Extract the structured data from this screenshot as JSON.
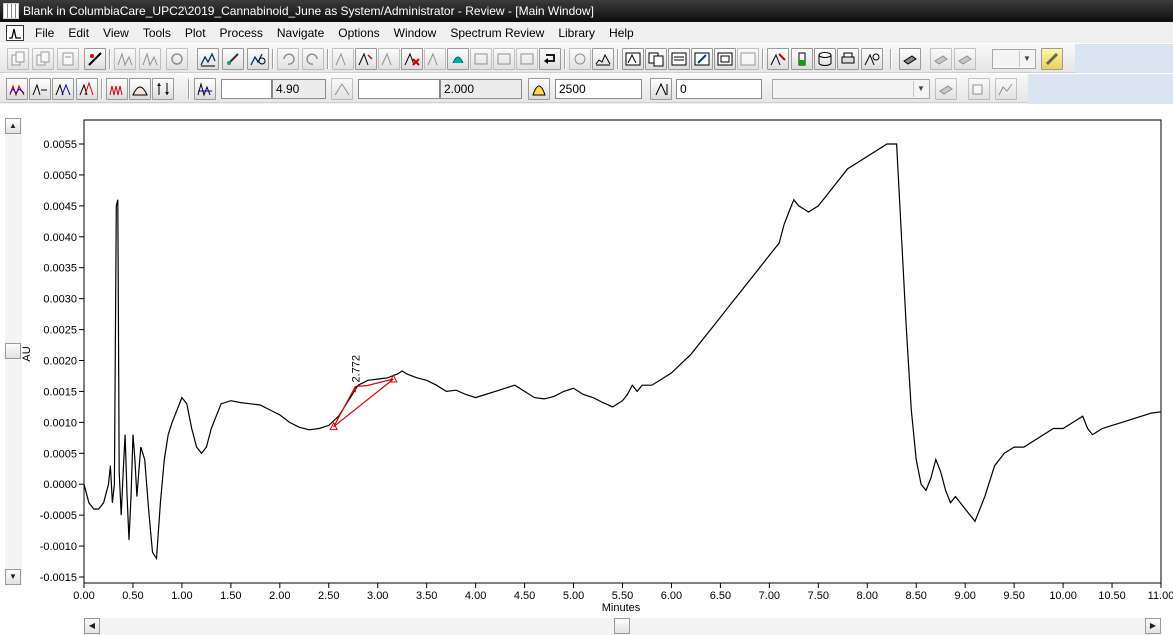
{
  "window": {
    "title": "Blank in ColumbiaCare_UPC2\\2019_Cannabinoid_June as System/Administrator - Review - [Main Window]"
  },
  "menu": [
    "File",
    "Edit",
    "View",
    "Tools",
    "Plot",
    "Process",
    "Navigate",
    "Options",
    "Window",
    "Spectrum Review",
    "Library",
    "Help"
  ],
  "toolbar2": {
    "field1_value": "4.90",
    "field2_value": "2.000",
    "field3_value": "2500",
    "field4_value": "0"
  },
  "chart_data": {
    "type": "line",
    "xlabel": "Minutes",
    "ylabel": "AU",
    "xlim": [
      0.0,
      11.0
    ],
    "ylim": [
      -0.0015,
      0.0055
    ],
    "x_ticks": [
      "0.00",
      "0.50",
      "1.00",
      "1.50",
      "2.00",
      "2.50",
      "3.00",
      "3.50",
      "4.00",
      "4.50",
      "5.00",
      "5.50",
      "6.00",
      "6.50",
      "7.00",
      "7.50",
      "8.00",
      "8.50",
      "9.00",
      "9.50",
      "10.00",
      "10.50",
      "11.00"
    ],
    "y_ticks": [
      "0.0055",
      "0.0050",
      "0.0045",
      "0.0040",
      "0.0035",
      "0.0030",
      "0.0025",
      "0.0020",
      "0.0015",
      "0.0010",
      "0.0005",
      "0.0000",
      "-0.0005",
      "-0.0010",
      "-0.0015"
    ],
    "series": [
      {
        "color": "#000000",
        "x": [
          0.0,
          0.05,
          0.1,
          0.15,
          0.2,
          0.25,
          0.27,
          0.29,
          0.31,
          0.33,
          0.345,
          0.36,
          0.38,
          0.4,
          0.42,
          0.44,
          0.46,
          0.48,
          0.5,
          0.52,
          0.54,
          0.56,
          0.58,
          0.62,
          0.66,
          0.7,
          0.74,
          0.78,
          0.82,
          0.86,
          0.9,
          0.95,
          1.0,
          1.05,
          1.1,
          1.15,
          1.2,
          1.25,
          1.3,
          1.4,
          1.5,
          1.6,
          1.7,
          1.8,
          1.9,
          2.0,
          2.1,
          2.2,
          2.3,
          2.4,
          2.5,
          2.6,
          2.7,
          2.8,
          2.9,
          3.0,
          3.1,
          3.2,
          3.25,
          3.3,
          3.4,
          3.5,
          3.6,
          3.7,
          3.8,
          3.9,
          4.0,
          4.1,
          4.2,
          4.3,
          4.4,
          4.5,
          4.6,
          4.7,
          4.8,
          4.9,
          5.0,
          5.1,
          5.2,
          5.3,
          5.4,
          5.5,
          5.55,
          5.6,
          5.65,
          5.7,
          5.8,
          5.9,
          6.0,
          6.1,
          6.2,
          6.3,
          6.4,
          6.5,
          6.6,
          6.7,
          6.8,
          6.9,
          7.0,
          7.1,
          7.15,
          7.2,
          7.25,
          7.3,
          7.35,
          7.4,
          7.5,
          7.6,
          7.7,
          7.8,
          7.9,
          8.0,
          8.1,
          8.2,
          8.3,
          8.35,
          8.4,
          8.45,
          8.5,
          8.55,
          8.6,
          8.65,
          8.7,
          8.75,
          8.8,
          8.85,
          8.9,
          8.95,
          9.0,
          9.1,
          9.2,
          9.3,
          9.4,
          9.5,
          9.6,
          9.7,
          9.8,
          9.9,
          10.0,
          10.1,
          10.2,
          10.25,
          10.3,
          10.35,
          10.4,
          10.5,
          10.6,
          10.7,
          10.8,
          10.9,
          11.0
        ],
        "y": [
          0.0,
          -0.0003,
          -0.0004,
          -0.0004,
          -0.0003,
          0.0,
          0.0003,
          -0.0003,
          0.0,
          0.0045,
          0.0046,
          0.0002,
          -0.0005,
          0.0002,
          0.0008,
          -0.0002,
          -0.0009,
          -0.0002,
          0.0008,
          0.0004,
          -0.0002,
          0.0002,
          0.0006,
          0.0004,
          -0.0004,
          -0.0011,
          -0.0012,
          -0.0003,
          0.0004,
          0.0008,
          0.001,
          0.0012,
          0.0014,
          0.0013,
          0.0009,
          0.0006,
          0.0005,
          0.0006,
          0.0009,
          0.0013,
          0.00135,
          0.00132,
          0.0013,
          0.00128,
          0.0012,
          0.00112,
          0.001,
          0.00092,
          0.00088,
          0.0009,
          0.00095,
          0.0011,
          0.00135,
          0.0016,
          0.00168,
          0.0017,
          0.00172,
          0.00178,
          0.00183,
          0.00178,
          0.00172,
          0.00168,
          0.0016,
          0.0015,
          0.00152,
          0.00145,
          0.0014,
          0.00145,
          0.0015,
          0.00155,
          0.0016,
          0.0015,
          0.0014,
          0.00138,
          0.00142,
          0.0015,
          0.00155,
          0.00145,
          0.0014,
          0.00132,
          0.00125,
          0.00135,
          0.00145,
          0.0016,
          0.0015,
          0.0016,
          0.0016,
          0.0017,
          0.0018,
          0.00195,
          0.0021,
          0.0023,
          0.0025,
          0.0027,
          0.0029,
          0.0031,
          0.0033,
          0.0035,
          0.0037,
          0.0039,
          0.0042,
          0.0044,
          0.0046,
          0.0045,
          0.00445,
          0.0044,
          0.0045,
          0.0047,
          0.0049,
          0.0051,
          0.0052,
          0.0053,
          0.0054,
          0.0055,
          0.0055,
          0.004,
          0.0025,
          0.0012,
          0.0004,
          0.0,
          -0.0001,
          0.0001,
          0.0004,
          0.0002,
          -0.0001,
          -0.0003,
          -0.0002,
          -0.0003,
          -0.0004,
          -0.0006,
          -0.0002,
          0.0003,
          0.0005,
          0.0006,
          0.0006,
          0.0007,
          0.0008,
          0.0009,
          0.0009,
          0.001,
          0.0011,
          0.0009,
          0.0008,
          0.00085,
          0.0009,
          0.00095,
          0.001,
          0.00105,
          0.0011,
          0.00115,
          0.00117
        ]
      }
    ],
    "integration": {
      "color": "#dd0000",
      "peak_label": "2.772",
      "start": {
        "x": 2.55,
        "y": 0.00093
      },
      "apex": {
        "x": 2.772,
        "y": 0.00158
      },
      "end": {
        "x": 3.16,
        "y": 0.0017
      },
      "baseline_color": "#dd0000"
    }
  }
}
